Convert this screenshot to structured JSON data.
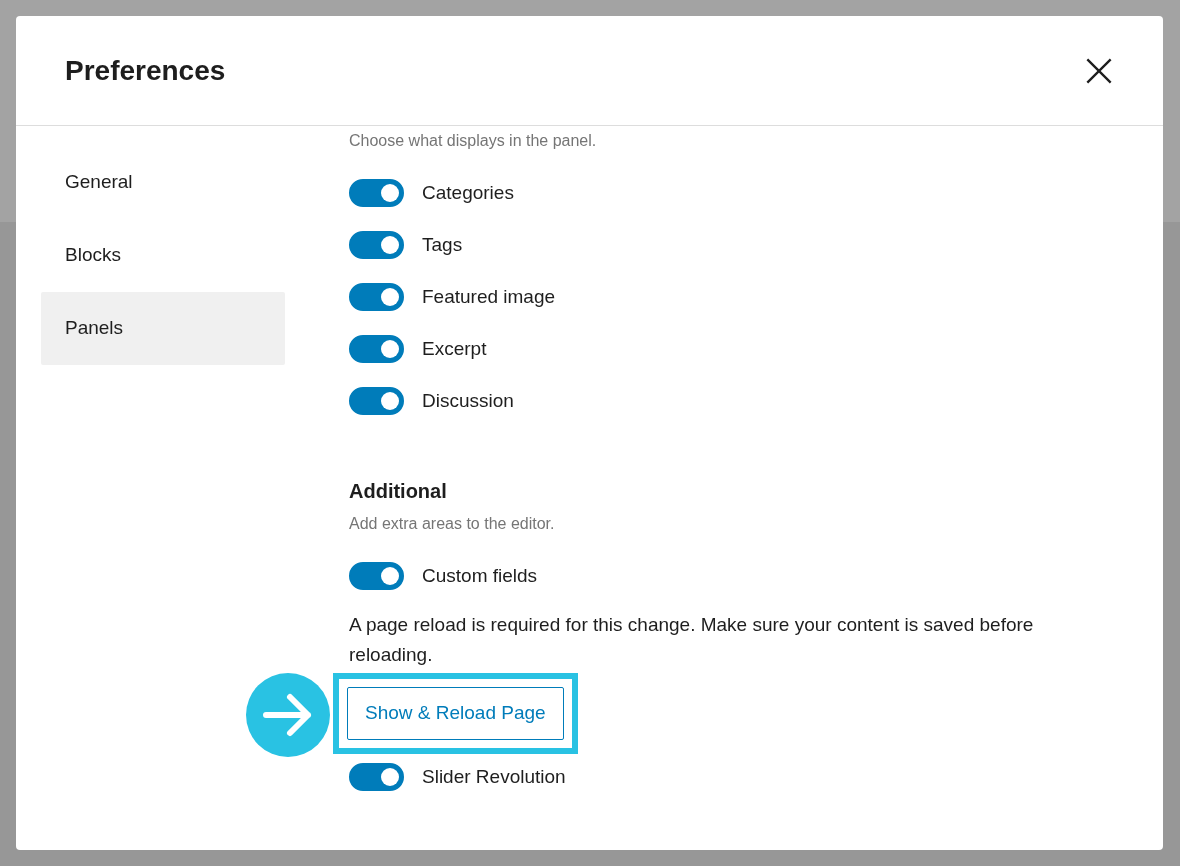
{
  "dialog": {
    "title": "Preferences"
  },
  "sidebar": {
    "items": [
      {
        "label": "General",
        "selected": false
      },
      {
        "label": "Blocks",
        "selected": false
      },
      {
        "label": "Panels",
        "selected": true
      }
    ]
  },
  "panels": {
    "description": "Choose what displays in the panel.",
    "toggles": [
      {
        "label": "Categories",
        "on": true
      },
      {
        "label": "Tags",
        "on": true
      },
      {
        "label": "Featured image",
        "on": true
      },
      {
        "label": "Excerpt",
        "on": true
      },
      {
        "label": "Discussion",
        "on": true
      }
    ]
  },
  "additional": {
    "heading": "Additional",
    "description": "Add extra areas to the editor.",
    "items": [
      {
        "kind": "toggle",
        "label": "Custom fields",
        "on": true
      },
      {
        "kind": "notice",
        "text": "A page reload is required for this change. Make sure your content is saved before reloading."
      },
      {
        "kind": "button",
        "label": "Show & Reload Page",
        "highlighted": true
      },
      {
        "kind": "toggle",
        "label": "Slider Revolution",
        "on": true
      }
    ]
  }
}
